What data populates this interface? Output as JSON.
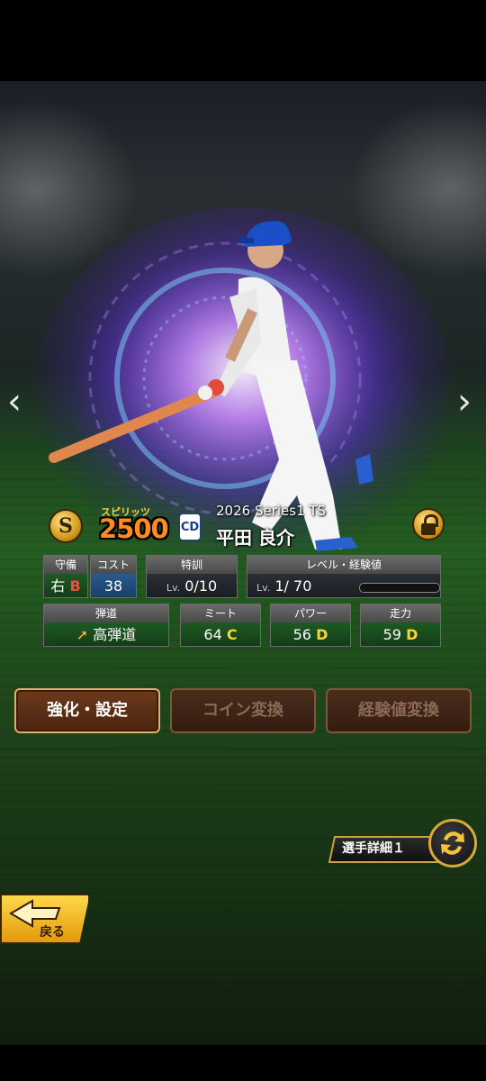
{
  "card": {
    "spirit_label": "スピリッツ",
    "spirit_value": "2500",
    "team_logo": "CD",
    "series": "2026 Series1 TS",
    "player_name": "平田 良介"
  },
  "stats": {
    "defense": {
      "label": "守備",
      "position": "右",
      "grade": "B"
    },
    "cost": {
      "label": "コスト",
      "value": "38"
    },
    "training": {
      "label": "特訓",
      "lv_prefix": "Lv.",
      "value": "0/10"
    },
    "level": {
      "label": "レベル・経験値",
      "lv_prefix": "Lv.",
      "value": "1/ 70",
      "exp_fraction": 0
    },
    "trajectory": {
      "label": "弾道",
      "value": "高弾道"
    },
    "meet": {
      "label": "ミート",
      "value": "64",
      "grade": "C"
    },
    "power": {
      "label": "パワー",
      "value": "56",
      "grade": "D"
    },
    "speed": {
      "label": "走力",
      "value": "59",
      "grade": "D"
    }
  },
  "actions": {
    "enhance": "強化・設定",
    "coin_convert": "コイン変換",
    "exp_convert": "経験値変換"
  },
  "detail_tab": "選手詳細１",
  "back": "戻る",
  "nav": {
    "prev": "‹",
    "next": "›"
  },
  "colors": {
    "accent_gold": "#d8a93a",
    "grade_b": "#ff4444",
    "grade_cd": "#ffd23a"
  }
}
